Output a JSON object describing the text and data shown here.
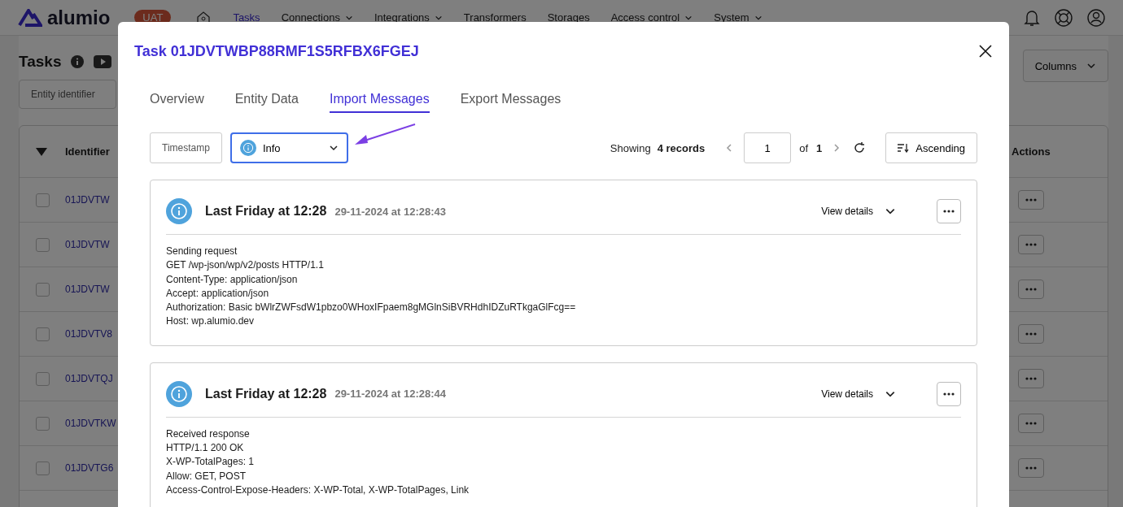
{
  "app": {
    "logo": "alumio",
    "environment": "UAT",
    "nav": [
      {
        "label": "Tasks",
        "selected": true,
        "dropdown": false
      },
      {
        "label": "Connections",
        "selected": false,
        "dropdown": true
      },
      {
        "label": "Integrations",
        "selected": false,
        "dropdown": true
      },
      {
        "label": "Transformers",
        "selected": false,
        "dropdown": false
      },
      {
        "label": "Storages",
        "selected": false,
        "dropdown": false
      },
      {
        "label": "Access control",
        "selected": false,
        "dropdown": true
      },
      {
        "label": "System",
        "selected": false,
        "dropdown": true
      }
    ]
  },
  "page": {
    "title": "Tasks",
    "filter": {
      "placeholder": "Entity identifier"
    },
    "columns_button": "Columns",
    "table": {
      "columns": [
        "Identifier",
        "Actions"
      ],
      "rows": [
        {
          "identifier": "01JDVTW",
          "checked": false
        },
        {
          "identifier": "01JDVTW",
          "checked": false
        },
        {
          "identifier": "01JDVTW",
          "checked": false
        },
        {
          "identifier": "01JDVTV8",
          "checked": false
        },
        {
          "identifier": "01JDVTQJ",
          "checked": false
        },
        {
          "identifier": "01JDVTKW",
          "checked": false
        },
        {
          "identifier": "01JDVTG6",
          "checked": false
        }
      ]
    }
  },
  "modal": {
    "title": "Task 01JDVTWBP88RMF1S5RFBX6FGEJ",
    "tabs": [
      {
        "label": "Overview",
        "selected": false
      },
      {
        "label": "Entity Data",
        "selected": false
      },
      {
        "label": "Import Messages",
        "selected": true
      },
      {
        "label": "Export Messages",
        "selected": false
      }
    ],
    "sort_field": "Timestamp",
    "level_filter": {
      "value": "Info",
      "focused": true
    },
    "showing_label": "Showing",
    "record_count": "4 records",
    "page": "1",
    "of_label": "of",
    "total_pages": "1",
    "order_button": "Ascending",
    "messages": [
      {
        "title": "Last Friday at 12:28",
        "timestamp": "29-11-2024 at 12:28:43",
        "details_label": "View details",
        "lines": [
          "Sending request",
          "GET /wp-json/wp/v2/posts HTTP/1.1",
          "Content-Type: application/json",
          "Accept: application/json",
          "Authorization: Basic bWlrZWFsdW1pbzo0WHoxIFpaem8gMGlnSiBVRHdhIDZuRTkgaGlFcg==",
          "Host: wp.alumio.dev"
        ]
      },
      {
        "title": "Last Friday at 12:28",
        "timestamp": "29-11-2024 at 12:28:44",
        "details_label": "View details",
        "lines": [
          "Received response",
          "HTTP/1.1 200 OK",
          "X-WP-TotalPages: 1",
          "Allow: GET, POST",
          "Access-Control-Expose-Headers: X-WP-Total, X-WP-TotalPages, Link"
        ]
      }
    ]
  }
}
